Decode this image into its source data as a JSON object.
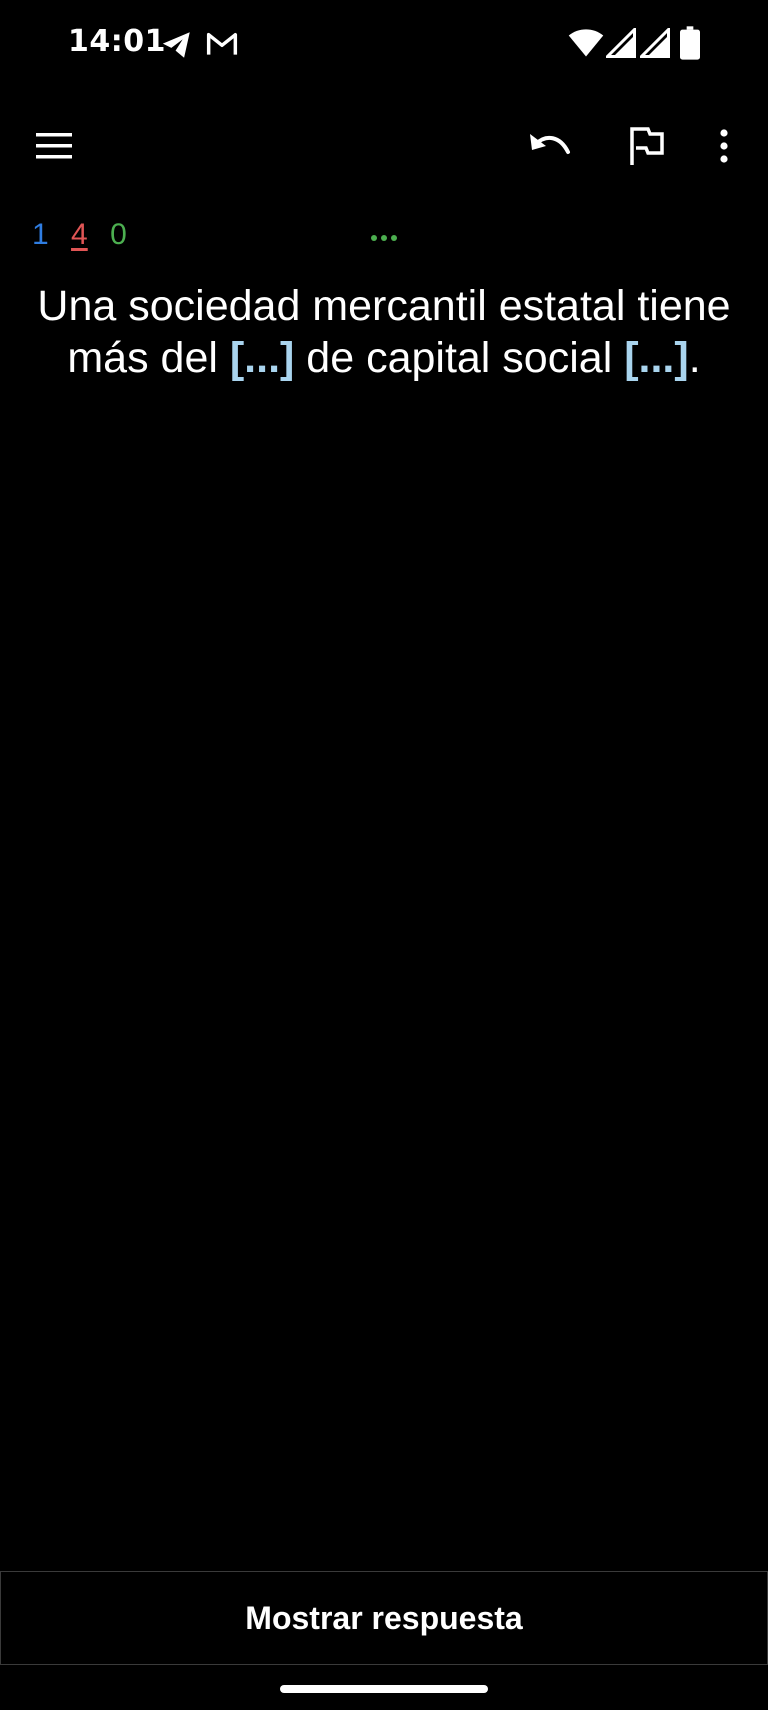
{
  "status_bar": {
    "time": "14:01",
    "icons": [
      "telegram-icon",
      "gmail-icon",
      "wifi-icon",
      "signal-icon",
      "signal-icon",
      "battery-icon"
    ]
  },
  "toolbar": {
    "menu_icon": "menu-icon",
    "undo_icon": "undo-icon",
    "flag_icon": "flag-icon",
    "more_icon": "more-vert-icon"
  },
  "counts": {
    "new": "1",
    "learning": "4",
    "review": "0",
    "colors": {
      "new": "#2f7de1",
      "learning": "#e05555",
      "review": "#4caf50"
    }
  },
  "question": {
    "part1": "Una sociedad mercantil estatal tiene más del ",
    "cloze1": "[...]",
    "part2": " de capital social ",
    "cloze2": "[...]",
    "part3": ".",
    "cloze_color": "#a9d4ee"
  },
  "answer_button": {
    "label": "Mostrar respuesta"
  }
}
